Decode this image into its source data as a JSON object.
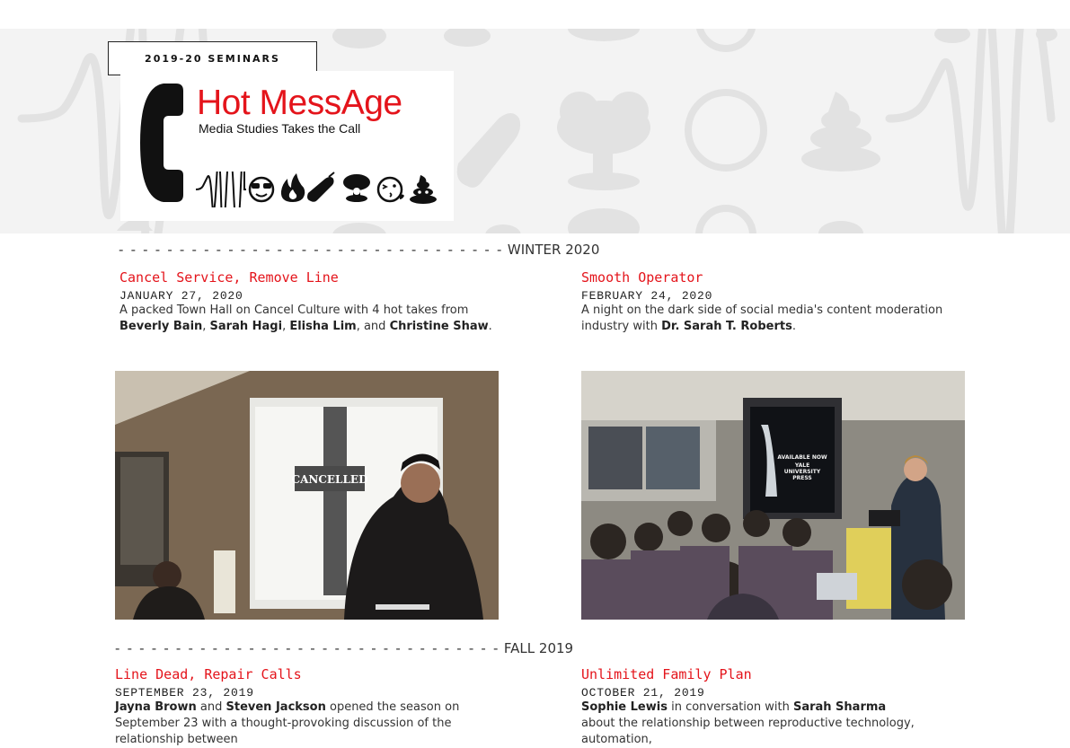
{
  "header": {
    "seminars_label": "2019-20 SEMINARS",
    "logo": {
      "title": "Hot MessAge",
      "subtitle": "Media Studies Takes the Call",
      "icons": [
        "phone-icon",
        "soundwave-icon",
        "sunglasses-emoji-icon",
        "fire-icon",
        "eggplant-icon",
        "mushroom-cloud-icon",
        "kiss-face-icon",
        "poop-icon"
      ]
    },
    "banner_icons": [
      "soundwave-icon",
      "sunglasses-emoji-icon",
      "eggplant-icon",
      "mushroom-cloud-icon",
      "kiss-face-icon",
      "poop-icon"
    ]
  },
  "sections": {
    "winter": {
      "dashes": "- - - - - - - - - - - - - - - - - - - - - - - - - - - - - - - -",
      "label": "WINTER 2020"
    },
    "fall": {
      "dashes": "- - - - - - - - - - - - - - - - - - - - - - - - - - - - - - - -",
      "label": "FALL 2019"
    }
  },
  "events": [
    {
      "title": "Cancel Service, Remove Line",
      "date": "JANUARY 27, 2020",
      "desc": [
        {
          "t": "A packed Town Hall on Cancel Culture with 4 hot takes from "
        },
        {
          "t": "Beverly Bain",
          "b": true
        },
        {
          "t": ", "
        },
        {
          "t": "Sarah Hagi",
          "b": true
        },
        {
          "t": ", "
        },
        {
          "t": "Elisha Lim",
          "b": true
        },
        {
          "t": ", and "
        },
        {
          "t": "Christine Shaw",
          "b": true
        },
        {
          "t": "."
        }
      ],
      "photo": {
        "slide_text": "CANCELLED"
      }
    },
    {
      "title": "Smooth Operator",
      "date": "FEBRUARY 24, 2020",
      "desc": [
        {
          "t": "A night on the dark side of social media's content moderation industry with "
        },
        {
          "t": "Dr. Sarah T. Roberts",
          "b": true
        },
        {
          "t": "."
        }
      ],
      "photo": {
        "slide_text": [
          "AVAILABLE NOW",
          "YALE",
          "UNIVERSITY",
          "PRESS"
        ]
      }
    },
    {
      "title": "Line Dead, Repair Calls",
      "date": "SEPTEMBER 23, 2019",
      "desc": [
        {
          "t": "Jayna Brown",
          "b": true
        },
        {
          "t": " and "
        },
        {
          "t": "Steven Jackson",
          "b": true
        },
        {
          "t": " opened the season on September 23 with a thought-provoking discussion of the relationship between"
        }
      ]
    },
    {
      "title": "Unlimited Family Plan",
      "date": "OCTOBER 21, 2019",
      "desc": [
        {
          "t": "Sophie Lewis",
          "b": true
        },
        {
          "t": " in conversation with "
        },
        {
          "t": "Sarah Sharma",
          "b": true
        },
        {
          "t": " about the relationship between reproductive technology, automation,"
        }
      ]
    }
  ],
  "colors": {
    "accent": "#e4141b",
    "banner_bg": "#f3f3f3",
    "banner_icon": "#e0e0e0"
  }
}
